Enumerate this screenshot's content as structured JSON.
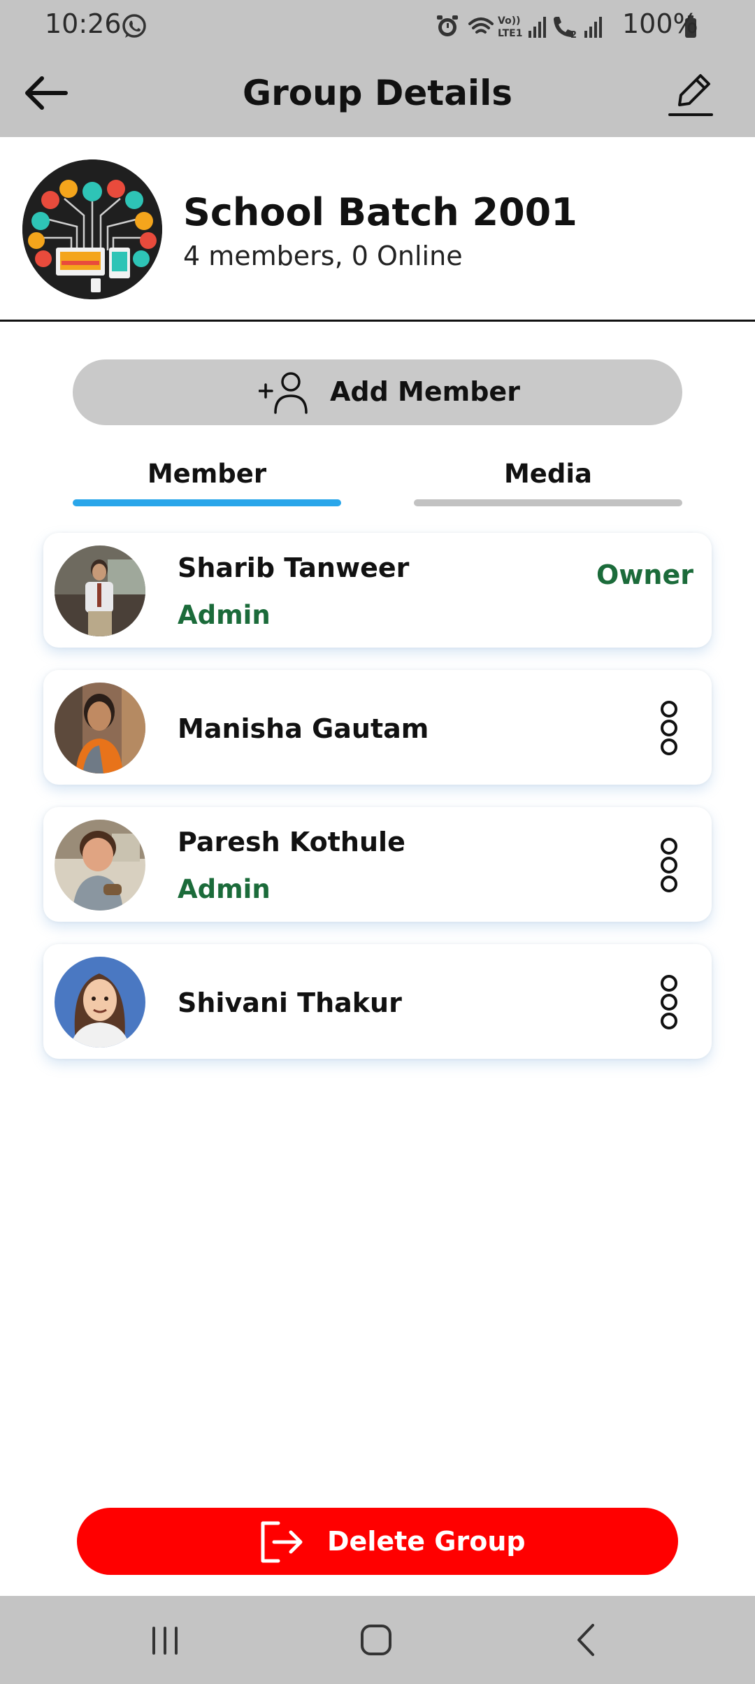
{
  "status_bar": {
    "time": "10:26",
    "battery": "100%",
    "icons": [
      "whatsapp-icon",
      "alarm-icon",
      "wifi-icon",
      "volte-icon",
      "signal-icon",
      "wifi-calling-icon",
      "signal-icon",
      "battery-icon"
    ]
  },
  "app_bar": {
    "title": "Group Details",
    "back_icon": "arrow-left-icon",
    "edit_icon": "pencil-icon"
  },
  "group": {
    "name": "School Batch 2001",
    "subtitle": "4 members, 0 Online"
  },
  "actions": {
    "add_member_label": "Add Member",
    "delete_group_label": "Delete Group"
  },
  "tabs": [
    {
      "label": "Member",
      "active": true
    },
    {
      "label": "Media",
      "active": false
    }
  ],
  "members": [
    {
      "name": "Sharib Tanweer",
      "role": "Admin",
      "tag": "Owner"
    },
    {
      "name": "Manisha Gautam",
      "role": "",
      "tag": ""
    },
    {
      "name": "Paresh Kothule",
      "role": "Admin",
      "tag": ""
    },
    {
      "name": "Shivani Thakur",
      "role": "",
      "tag": ""
    }
  ],
  "colors": {
    "bars": "#c4c4c4",
    "active_tab": "#2aa6ea",
    "admin_text": "#1b6b3a",
    "delete_button": "#ff0000"
  }
}
